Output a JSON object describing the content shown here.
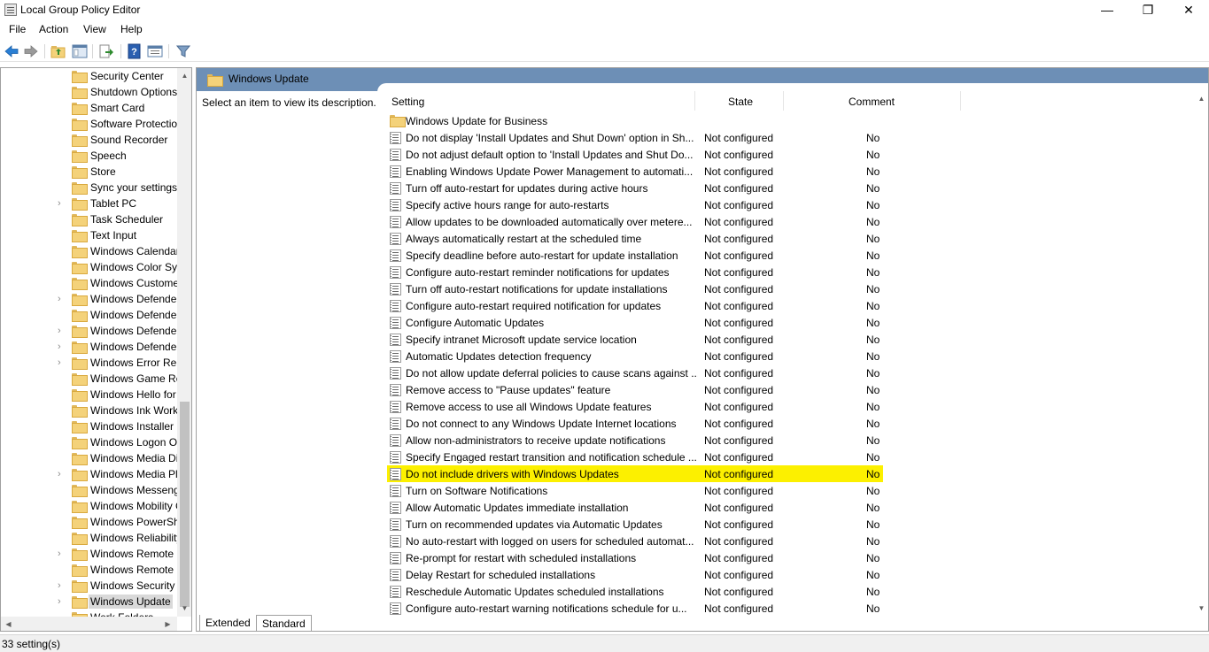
{
  "window": {
    "title": "Local Group Policy Editor",
    "controls": {
      "minimize": "—",
      "maximize": "❐",
      "close": "✕"
    }
  },
  "menu": [
    "File",
    "Action",
    "View",
    "Help"
  ],
  "toolbar": {
    "icons": [
      "back-arrow-icon",
      "forward-arrow-icon",
      "up-folder-icon",
      "show-hide-tree-icon",
      "export-list-icon",
      "help-icon",
      "properties-icon",
      "filter-icon"
    ]
  },
  "tree": {
    "items": [
      {
        "label": "Security Center",
        "expandable": false
      },
      {
        "label": "Shutdown Options",
        "expandable": false
      },
      {
        "label": "Smart Card",
        "expandable": false
      },
      {
        "label": "Software Protection Platform",
        "expandable": false
      },
      {
        "label": "Sound Recorder",
        "expandable": false
      },
      {
        "label": "Speech",
        "expandable": false
      },
      {
        "label": "Store",
        "expandable": false
      },
      {
        "label": "Sync your settings",
        "expandable": false
      },
      {
        "label": "Tablet PC",
        "expandable": true
      },
      {
        "label": "Task Scheduler",
        "expandable": false
      },
      {
        "label": "Text Input",
        "expandable": false
      },
      {
        "label": "Windows Calendar",
        "expandable": false
      },
      {
        "label": "Windows Color System",
        "expandable": false
      },
      {
        "label": "Windows Customer Experience",
        "expandable": false
      },
      {
        "label": "Windows Defender Antivirus",
        "expandable": true
      },
      {
        "label": "Windows Defender Application Guard",
        "expandable": false
      },
      {
        "label": "Windows Defender Exploit Guard",
        "expandable": true
      },
      {
        "label": "Windows Defender SmartScreen",
        "expandable": true
      },
      {
        "label": "Windows Error Reporting",
        "expandable": true
      },
      {
        "label": "Windows Game Recording",
        "expandable": false
      },
      {
        "label": "Windows Hello for Business",
        "expandable": false
      },
      {
        "label": "Windows Ink Workspace",
        "expandable": false
      },
      {
        "label": "Windows Installer",
        "expandable": false
      },
      {
        "label": "Windows Logon Options",
        "expandable": false
      },
      {
        "label": "Windows Media Digital Rights",
        "expandable": false
      },
      {
        "label": "Windows Media Player",
        "expandable": true
      },
      {
        "label": "Windows Messenger",
        "expandable": false
      },
      {
        "label": "Windows Mobility Center",
        "expandable": false
      },
      {
        "label": "Windows PowerShell",
        "expandable": false
      },
      {
        "label": "Windows Reliability Analysis",
        "expandable": false
      },
      {
        "label": "Windows Remote Management",
        "expandable": true
      },
      {
        "label": "Windows Remote Shell",
        "expandable": false
      },
      {
        "label": "Windows Security",
        "expandable": true
      },
      {
        "label": "Windows Update",
        "expandable": true,
        "selected": true
      },
      {
        "label": "Work Folders",
        "expandable": false
      }
    ]
  },
  "pane": {
    "title": "Windows Update",
    "description": "Select an item to view its description.",
    "columns": {
      "setting": "Setting",
      "state": "State",
      "comment": "Comment"
    },
    "rows": [
      {
        "setting": "Windows Update for Business",
        "folder": true,
        "state": "",
        "comment": ""
      },
      {
        "setting": "Do not display 'Install Updates and Shut Down' option in Sh...",
        "state": "Not configured",
        "comment": "No"
      },
      {
        "setting": "Do not adjust default option to 'Install Updates and Shut Do...",
        "state": "Not configured",
        "comment": "No"
      },
      {
        "setting": "Enabling Windows Update Power Management to automati...",
        "state": "Not configured",
        "comment": "No"
      },
      {
        "setting": "Turn off auto-restart for updates during active hours",
        "state": "Not configured",
        "comment": "No"
      },
      {
        "setting": "Specify active hours range for auto-restarts",
        "state": "Not configured",
        "comment": "No"
      },
      {
        "setting": "Allow updates to be downloaded automatically over metere...",
        "state": "Not configured",
        "comment": "No"
      },
      {
        "setting": "Always automatically restart at the scheduled time",
        "state": "Not configured",
        "comment": "No"
      },
      {
        "setting": "Specify deadline before auto-restart for update installation",
        "state": "Not configured",
        "comment": "No"
      },
      {
        "setting": "Configure auto-restart reminder notifications for updates",
        "state": "Not configured",
        "comment": "No"
      },
      {
        "setting": "Turn off auto-restart notifications for update installations",
        "state": "Not configured",
        "comment": "No"
      },
      {
        "setting": "Configure auto-restart required notification for updates",
        "state": "Not configured",
        "comment": "No"
      },
      {
        "setting": "Configure Automatic Updates",
        "state": "Not configured",
        "comment": "No"
      },
      {
        "setting": "Specify intranet Microsoft update service location",
        "state": "Not configured",
        "comment": "No"
      },
      {
        "setting": "Automatic Updates detection frequency",
        "state": "Not configured",
        "comment": "No"
      },
      {
        "setting": "Do not allow update deferral policies to cause scans against ...",
        "state": "Not configured",
        "comment": "No"
      },
      {
        "setting": "Remove access to \"Pause updates\" feature",
        "state": "Not configured",
        "comment": "No"
      },
      {
        "setting": "Remove access to use all Windows Update features",
        "state": "Not configured",
        "comment": "No"
      },
      {
        "setting": "Do not connect to any Windows Update Internet locations",
        "state": "Not configured",
        "comment": "No"
      },
      {
        "setting": "Allow non-administrators to receive update notifications",
        "state": "Not configured",
        "comment": "No"
      },
      {
        "setting": "Specify Engaged restart transition and notification schedule ...",
        "state": "Not configured",
        "comment": "No"
      },
      {
        "setting": "Do not include drivers with Windows Updates",
        "state": "Not configured",
        "comment": "No",
        "highlight": true
      },
      {
        "setting": "Turn on Software Notifications",
        "state": "Not configured",
        "comment": "No"
      },
      {
        "setting": "Allow Automatic Updates immediate installation",
        "state": "Not configured",
        "comment": "No"
      },
      {
        "setting": "Turn on recommended updates via Automatic Updates",
        "state": "Not configured",
        "comment": "No"
      },
      {
        "setting": "No auto-restart with logged on users for scheduled automat...",
        "state": "Not configured",
        "comment": "No"
      },
      {
        "setting": "Re-prompt for restart with scheduled installations",
        "state": "Not configured",
        "comment": "No"
      },
      {
        "setting": "Delay Restart for scheduled installations",
        "state": "Not configured",
        "comment": "No"
      },
      {
        "setting": "Reschedule Automatic Updates scheduled installations",
        "state": "Not configured",
        "comment": "No"
      },
      {
        "setting": "Configure auto-restart warning notifications schedule for u...",
        "state": "Not configured",
        "comment": "No"
      }
    ]
  },
  "tabs": [
    "Extended",
    "Standard"
  ],
  "status": "33 setting(s)",
  "colors": {
    "highlight": "#fcf000",
    "pane_header": "#6d8fb6"
  }
}
